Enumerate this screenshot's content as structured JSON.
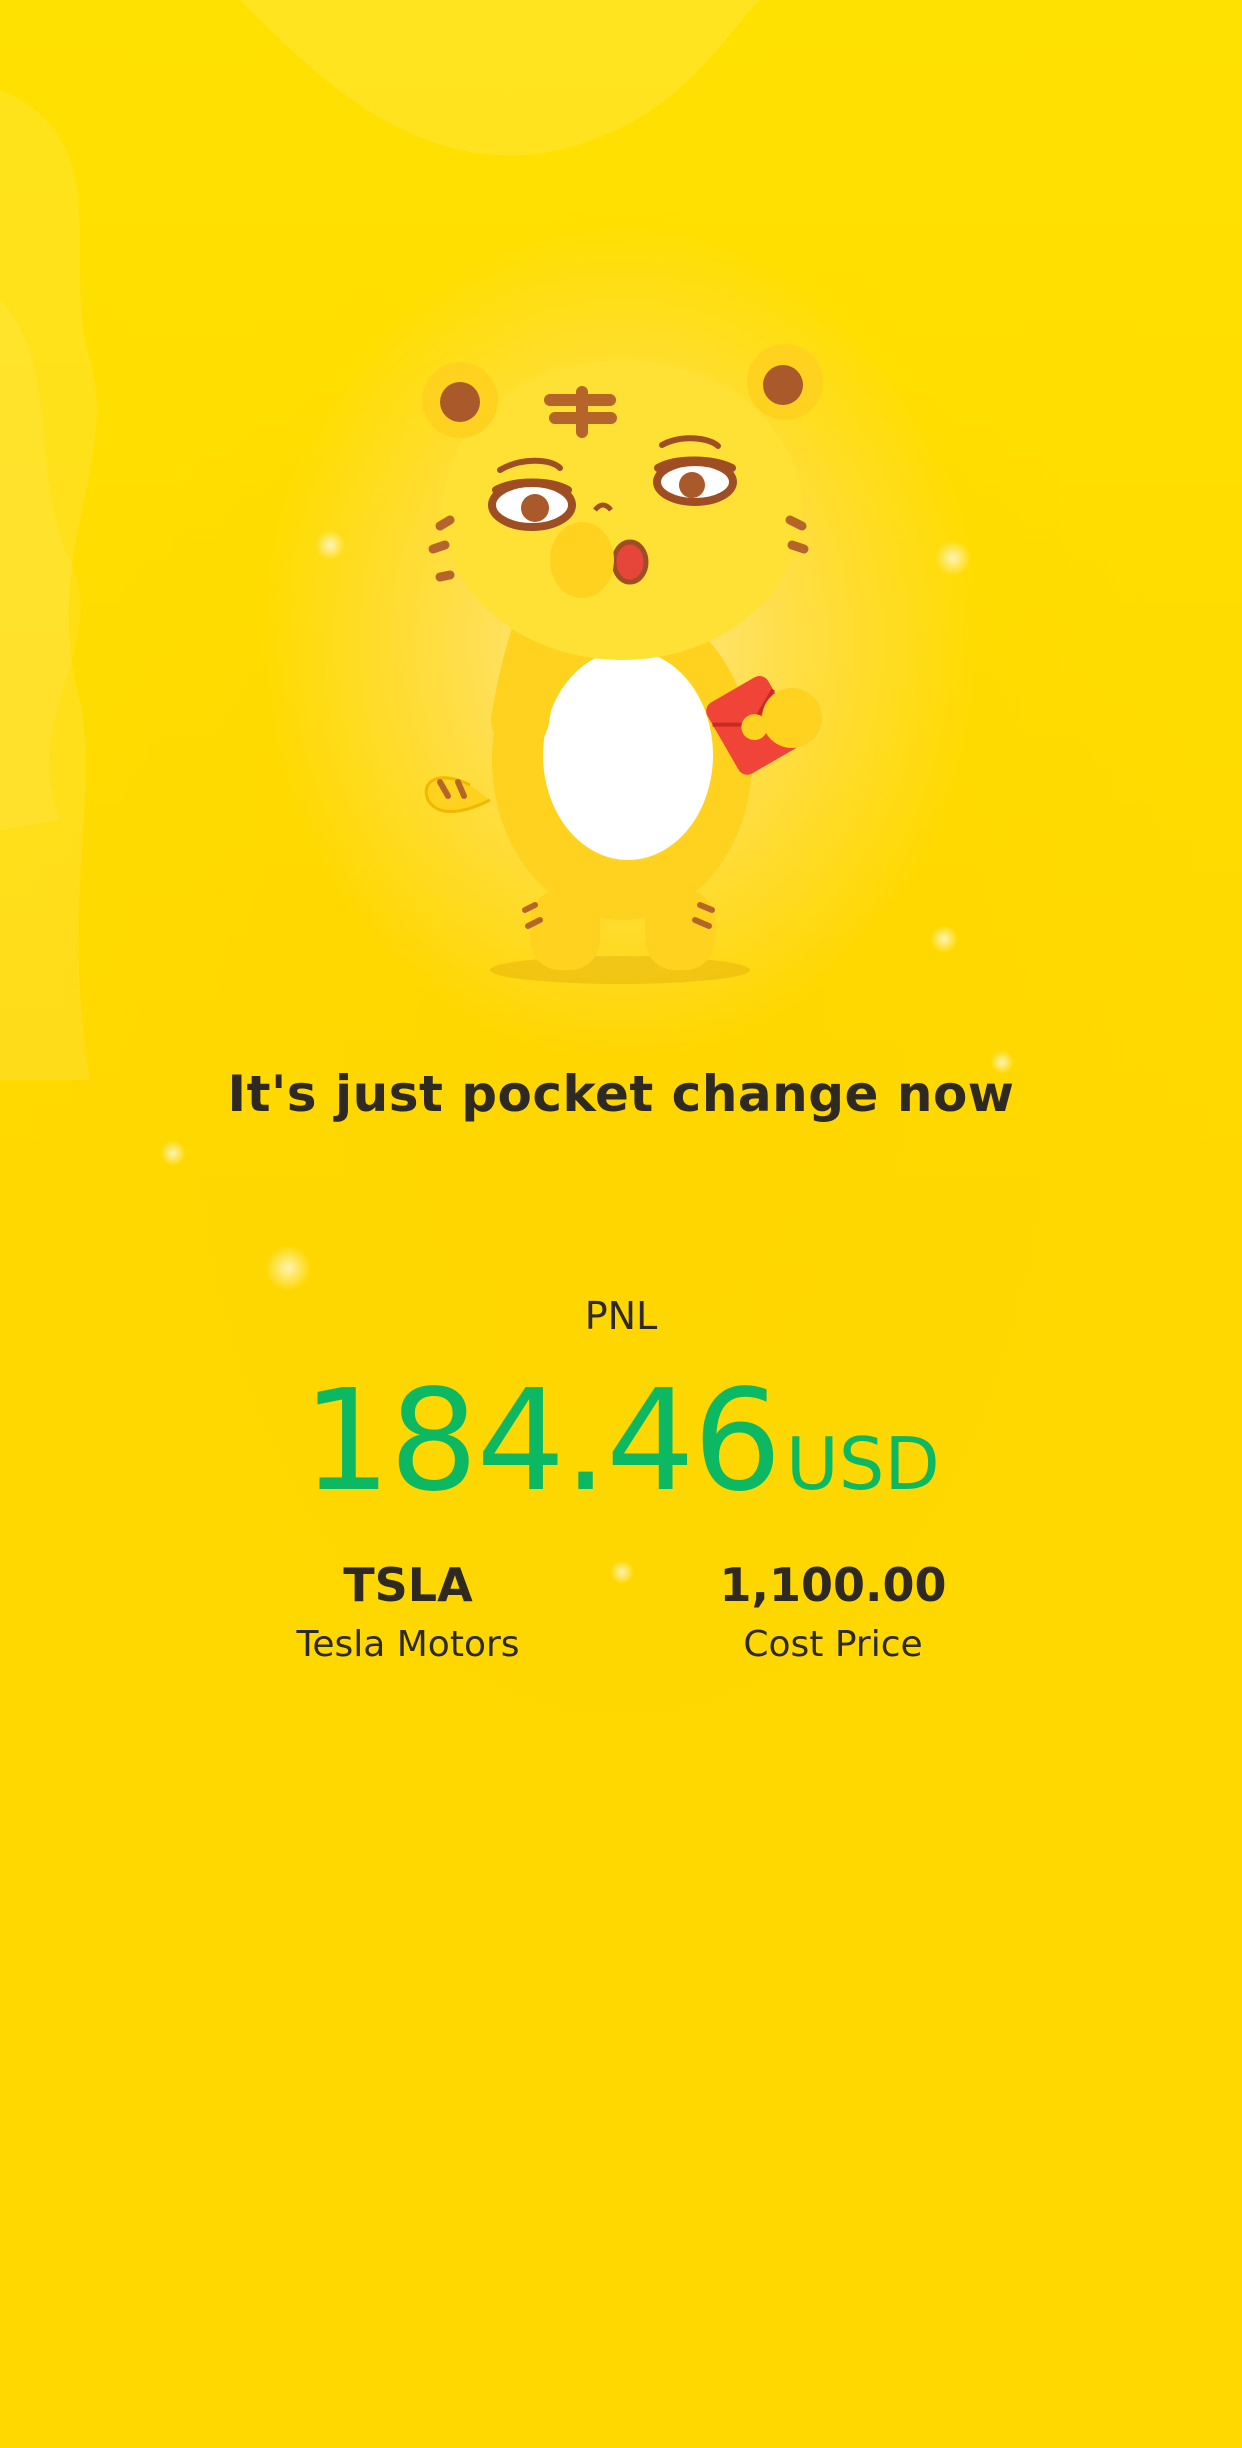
{
  "headline": "It's just pocket change now",
  "pnl": {
    "label": "PNL",
    "value": "184.46",
    "unit": "USD"
  },
  "stock": {
    "symbol": "TSLA",
    "name": "Tesla Motors"
  },
  "cost": {
    "value": "1,100.00",
    "label": "Cost Price"
  },
  "colors": {
    "background": "#FFD900",
    "profit_green": "#0DB862",
    "text_dark": "#2E2A22",
    "envelope_red": "#F04438"
  },
  "illustration": "tiger-mascot-holding-red-envelope"
}
